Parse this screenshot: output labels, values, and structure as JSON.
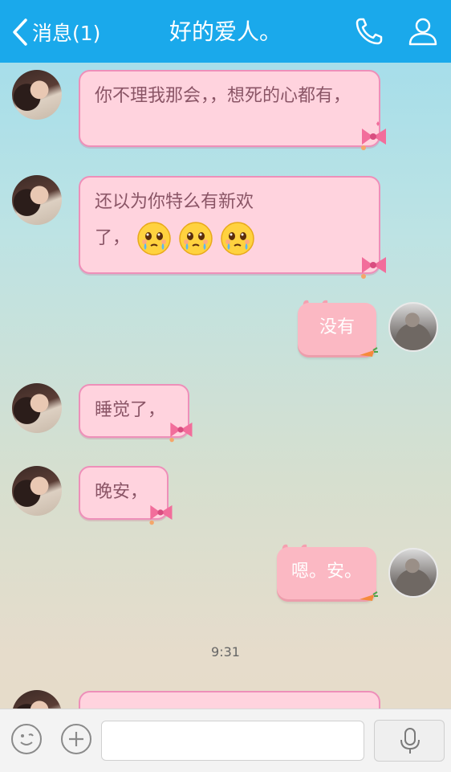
{
  "header": {
    "back_label": "消息(1)",
    "title": "好的爱人。",
    "phone_icon": "phone-icon",
    "profile_icon": "user-profile-icon"
  },
  "messages": [
    {
      "from": "her",
      "text": "你不理我那会，，想死的心都有，"
    },
    {
      "from": "her",
      "text_line1": "还以为你特么有新欢",
      "text_line2": "了，",
      "emojis": [
        "crying-face-emoji",
        "crying-face-emoji",
        "crying-face-emoji"
      ]
    },
    {
      "from": "me",
      "text": "没有"
    },
    {
      "from": "her",
      "text": "睡觉了，"
    },
    {
      "from": "her",
      "text": "晚安，"
    },
    {
      "from": "me",
      "text": "嗯。安。"
    }
  ],
  "timestamp": "9:31",
  "input": {
    "placeholder": "",
    "value": ""
  },
  "colors": {
    "header_bg": "#1aa9eb",
    "bubble_her_bg": "#ffd3de",
    "bubble_her_border": "#ee8fb9",
    "bubble_me_bg": "#fbb8c3"
  }
}
